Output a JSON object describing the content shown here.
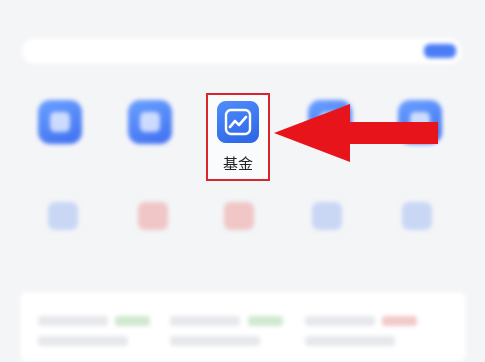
{
  "status_bar": {
    "left": "",
    "time": "",
    "right": ""
  },
  "search": {
    "placeholder": "",
    "button": ""
  },
  "apps_row1": [
    {
      "label": "",
      "style": "blue"
    },
    {
      "label": "",
      "style": "blue"
    },
    {
      "label": "基金",
      "style": "highlight",
      "icon": "trend-chart-icon"
    },
    {
      "label": "",
      "style": "blue"
    },
    {
      "label": "",
      "style": "blue"
    }
  ],
  "apps_row2": [
    {
      "label": "",
      "style": "pale"
    },
    {
      "label": "",
      "style": "red"
    },
    {
      "label": "",
      "style": "red"
    },
    {
      "label": "",
      "style": "pale"
    },
    {
      "label": "",
      "style": "pale"
    }
  ],
  "colors": {
    "highlight_border": "#d8262c",
    "arrow": "#e8141b",
    "icon_blue": "#3f6ff0"
  }
}
